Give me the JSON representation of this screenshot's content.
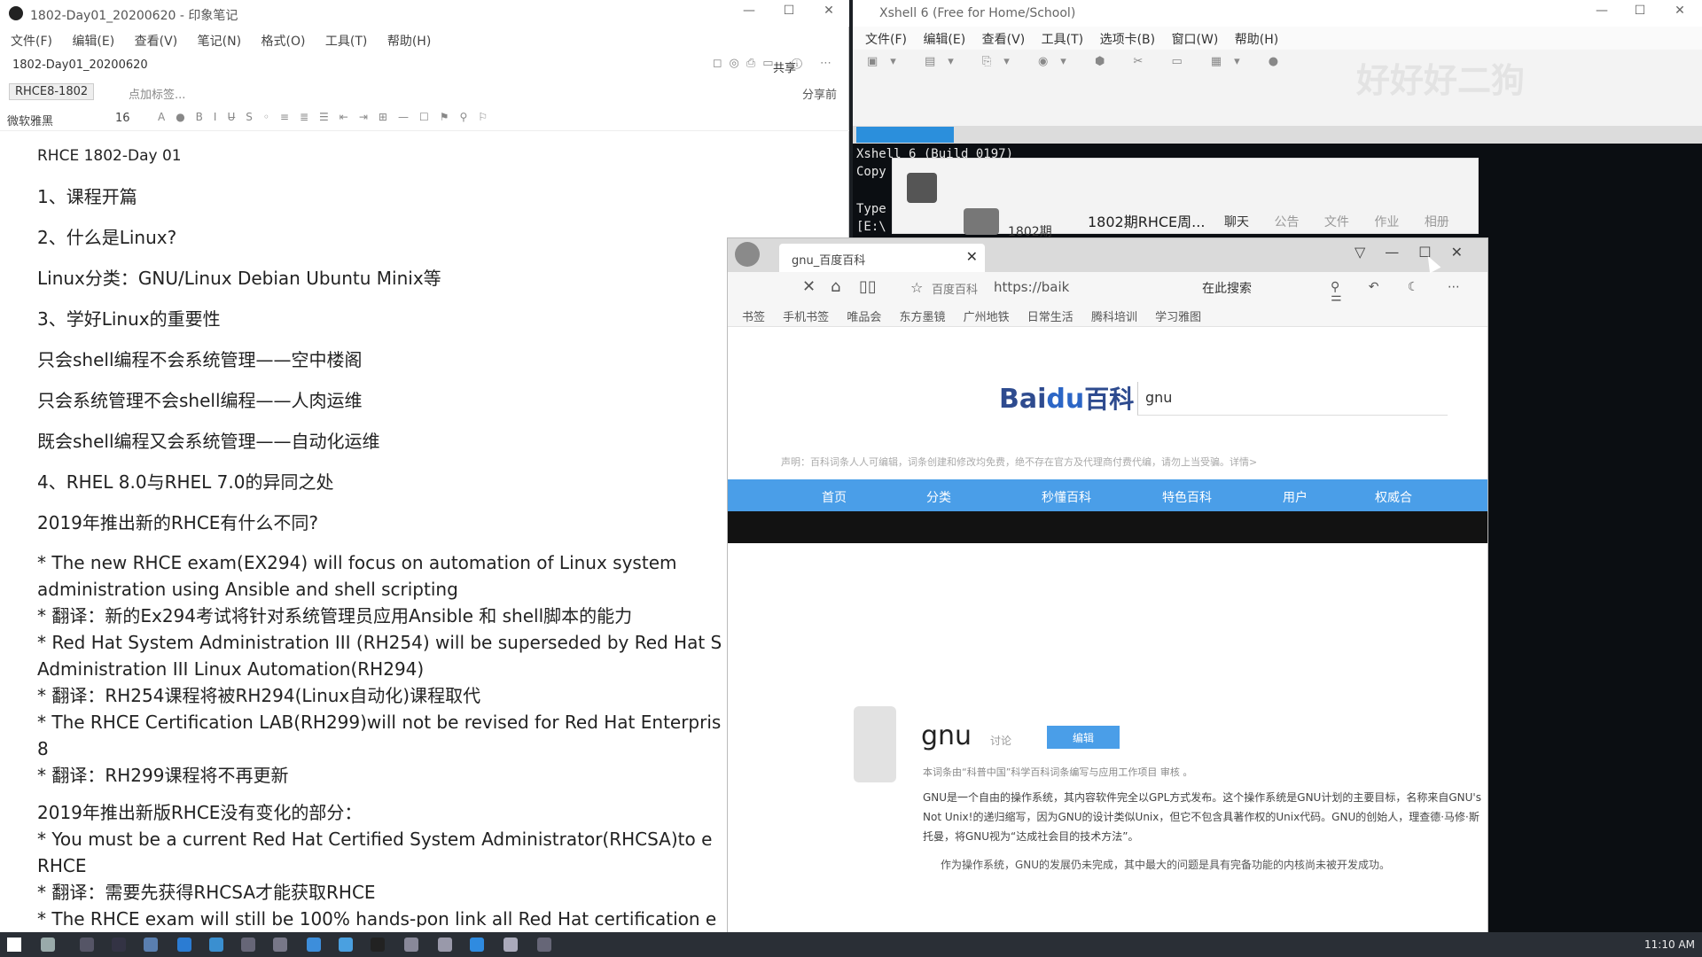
{
  "evernote": {
    "title": "1802-Day01_20200620 - 印象笔记",
    "menu": [
      "文件(F)",
      "编辑(E)",
      "查看(V)",
      "笔记(N)",
      "格式(O)",
      "工具(T)",
      "帮助(H)"
    ],
    "note_title": "1802-Day01_20200620",
    "share_label": "共享",
    "notebook": "RHCE8-1802",
    "tag_placeholder": "点加标签...",
    "right_label": "分享前",
    "font_name": "微软雅黑",
    "font_size": "16",
    "body": {
      "heading": "RHCE 1802-Day 01",
      "l1": "1、课程开篇",
      "l2": "2、什么是Linux?",
      "l3": "Linux分类：GNU/Linux Debian Ubuntu Minix等",
      "l4": "3、学好Linux的重要性",
      "l5": "只会shell编程不会系统管理——空中楼阁",
      "l6": "只会系统管理不会shell编程——人肉运维",
      "l7": "既会shell编程又会系统管理——自动化运维",
      "l8": "4、RHEL 8.0与RHEL 7.0的异同之处",
      "l9": "2019年推出新的RHCE有什么不同?",
      "e1": "* The new RHCE exam(EX294) will focus on automation of Linux system",
      "e2": "administration using Ansible and shell scripting",
      "e3": "* 翻译：新的Ex294考试将针对系统管理员应用Ansible 和 shell脚本的能力",
      "e4": "* Red Hat System Administration III (RH254) will be superseded by Red Hat S",
      "e5": "Administration III Linux Automation(RH294)",
      "e6": "* 翻译：RH254课程将被RH294(Linux自动化)课程取代",
      "e7": "* The RHCE Certification LAB(RH299)will not be revised for Red Hat Enterpris",
      "e8": "8",
      "e9": "* 翻译：RH299课程将不再更新",
      "e10": "2019年推出新版RHCE没有变化的部分：",
      "e11": "* You must be a current Red Hat Certified System Administrator(RHCSA)to e",
      "e12": "RHCE",
      "e13": "* 翻译：需要先获得RHCSA才能获取RHCE",
      "e14": "* The RHCE exam will still be 100% hands-pon link all Red Hat certification e"
    }
  },
  "xshell": {
    "title": "Xshell 6 (Free for Home/School)",
    "menu": [
      "文件(F)",
      "编辑(E)",
      "查看(V)",
      "工具(T)",
      "选项卡(B)",
      "窗口(W)",
      "帮助(H)"
    ],
    "watermark": "好好好二狗",
    "term_l1": "Xshell 6 (Build 0197)",
    "term_l2": "Copy",
    "term_l3": "Type",
    "term_l4": "[E:\\"
  },
  "qq": {
    "group_short": "1802期",
    "group_name": "1802期RHCE周...",
    "tabs": [
      "聊天",
      "公告",
      "文件",
      "作业",
      "相册"
    ]
  },
  "browser": {
    "tab_title": "gnu_百度百科",
    "site_label": "百度百科",
    "url": "https://baik",
    "search_here": "在此搜索",
    "bookmarks": [
      "书签",
      "手机书签",
      "唯品会",
      "东方墨镜",
      "广州地铁",
      "日常生活",
      "腾科培训",
      "学习雅图"
    ],
    "baike": {
      "logo_text": "Bai",
      "logo_du": "du",
      "logo_suffix": "百科",
      "search_value": "gnu",
      "notice": "声明：百科词条人人可编辑，词条创建和修改均免费，绝不存在官方及代理商付费代编，请勿上当受骗。详情>",
      "nav": [
        "首页",
        "分类",
        "秒懂百科",
        "特色百科",
        "用户",
        "权威合"
      ],
      "entry_title": "gnu",
      "discuss": "讨论",
      "edit_btn": "编辑",
      "cert": "本词条由“科普中国”科学百科词条编写与应用工作项目 审核 。",
      "p1": "GNU是一个自由的操作系统，其内容软件完全以GPL方式发布。这个操作系统是GNU计划的主要目标，名称来自GNU's Not Unix!的递归缩写，因为GNU的设计类似Unix，但它不包含具著作权的Unix代码。GNU的创始人，理查德·马修·斯托曼，将GNU视为“达成社会目的技术方法”。",
      "p2": "作为操作系统，GNU的发展仍未完成，其中最大的问题是具有完备功能的内核尚未被开发成功。"
    }
  },
  "taskbar": {
    "clock": "11:10 AM"
  }
}
